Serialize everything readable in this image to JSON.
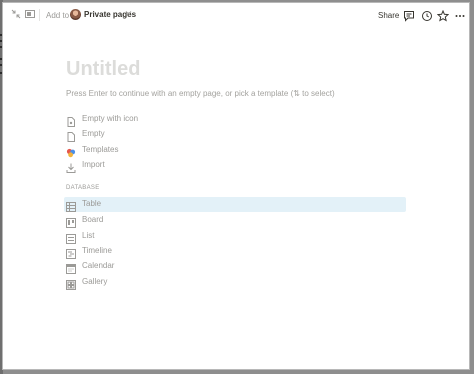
{
  "topbar": {
    "add_to": "Add to",
    "location": "Private pages",
    "share": "Share"
  },
  "page": {
    "title_placeholder": "Untitled",
    "hint": "Press Enter to continue with an empty page, or pick a template (⇅ to select)"
  },
  "options": [
    {
      "label": "Empty with icon",
      "icon": "page-with-icon-icon"
    },
    {
      "label": "Empty",
      "icon": "page-icon"
    },
    {
      "label": "Templates",
      "icon": "templates-icon"
    },
    {
      "label": "Import",
      "icon": "import-icon"
    }
  ],
  "database": {
    "section_label": "DATABASE",
    "items": [
      {
        "label": "Table",
        "icon": "table-icon",
        "selected": true
      },
      {
        "label": "Board",
        "icon": "board-icon"
      },
      {
        "label": "List",
        "icon": "list-icon"
      },
      {
        "label": "Timeline",
        "icon": "timeline-icon"
      },
      {
        "label": "Calendar",
        "icon": "calendar-icon"
      },
      {
        "label": "Gallery",
        "icon": "gallery-icon"
      }
    ]
  },
  "colors": {
    "selected_bg": "#e3f1f8",
    "muted_text": "#9b9a97",
    "title_placeholder": "#dcdcda"
  }
}
